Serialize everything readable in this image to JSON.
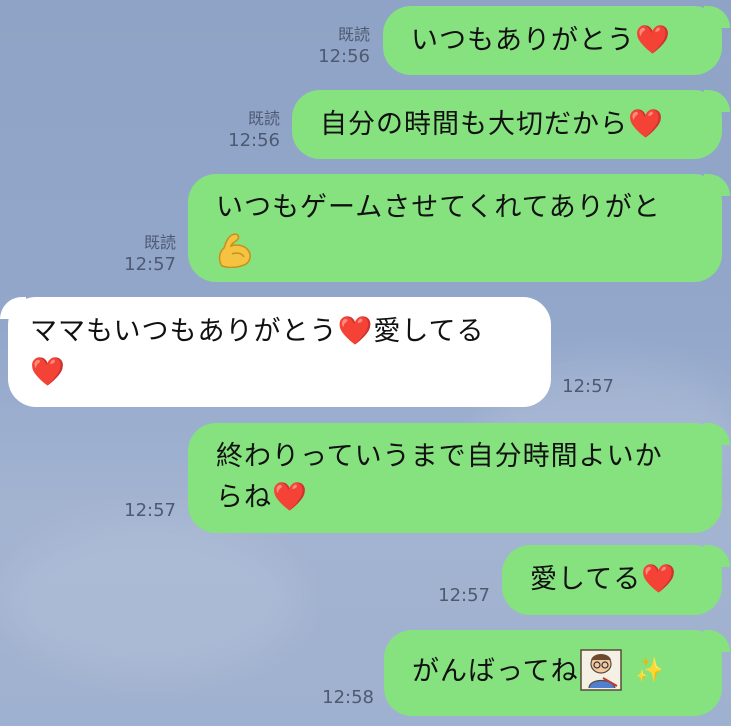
{
  "messages": [
    {
      "side": "out",
      "text": "いつもありがとう",
      "emoji": "heart-icon",
      "read": "既読",
      "time": "12:56"
    },
    {
      "side": "out",
      "text": "自分の時間も大切だから",
      "emoji": "heart-icon",
      "read": "既読",
      "time": "12:56"
    },
    {
      "side": "out",
      "text_line1": "いつもゲームさせてくれてありがと",
      "emoji": "flexed-biceps-icon",
      "read": "既読",
      "time": "12:57"
    },
    {
      "side": "in",
      "text_line1": "ママもいつもありがとう",
      "text_line1b": "愛してる",
      "emoji": "heart-icon",
      "time": "12:57"
    },
    {
      "side": "out",
      "text_line1": "終わりっていうまで自分時間よいか",
      "text_line2": "らね",
      "emoji": "heart-icon",
      "time": "12:57"
    },
    {
      "side": "out",
      "text": "愛してる",
      "emoji": "heart-icon",
      "time": "12:57"
    },
    {
      "side": "out",
      "text": "がんばってね",
      "emoji": "studying-person-sparkles-icon",
      "time": "12:58"
    }
  ],
  "colors": {
    "outgoing_bubble": "#86e27e",
    "incoming_bubble": "#ffffff",
    "background": "#93a7cb",
    "meta_text": "#4e5a72"
  }
}
